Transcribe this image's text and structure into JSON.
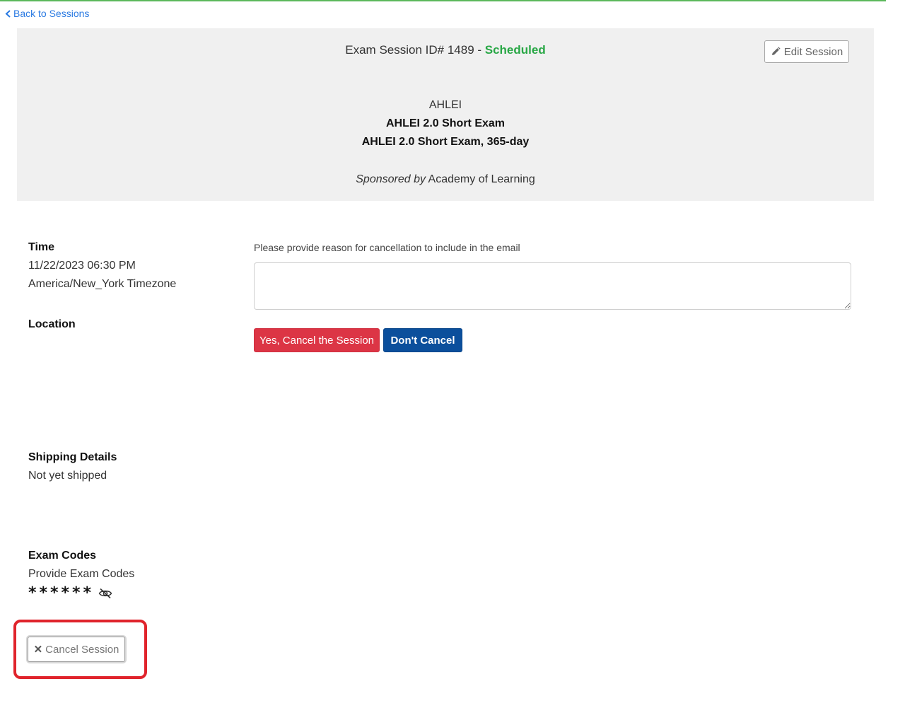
{
  "nav": {
    "back_label": "Back to Sessions"
  },
  "header": {
    "session_prefix": "Exam Session ID# 1489 - ",
    "status": "Scheduled",
    "edit_label": "Edit Session",
    "organization": "AHLEI",
    "exam_name": "AHLEI 2.0 Short Exam",
    "exam_variant": "AHLEI 2.0 Short Exam, 365-day",
    "sponsor_prefix": "Sponsored by",
    "sponsor_name": "Academy of Learning"
  },
  "details": {
    "time_label": "Time",
    "time_value": "11/22/2023 06:30 PM",
    "timezone": "America/New_York Timezone",
    "location_label": "Location",
    "shipping_label": "Shipping Details",
    "shipping_value": "Not yet shipped",
    "codes_label": "Exam Codes",
    "codes_value": "Provide Exam Codes",
    "codes_masked": "******"
  },
  "cancel_form": {
    "prompt": "Please provide reason for cancellation to include in the email",
    "reason_value": "",
    "confirm_label": "Yes, Cancel the Session",
    "dismiss_label": "Don't Cancel"
  },
  "actions": {
    "cancel_session_label": "Cancel Session"
  },
  "colors": {
    "status_green": "#28a745",
    "danger": "#dc3545",
    "primary": "#0b4f9c",
    "link": "#2a7ae2",
    "highlight": "#e0242c"
  },
  "icons": {
    "back": "chevron-left-icon",
    "edit": "pencil-icon",
    "toggle_codes": "eye-slash-icon",
    "cancel": "close-icon"
  }
}
